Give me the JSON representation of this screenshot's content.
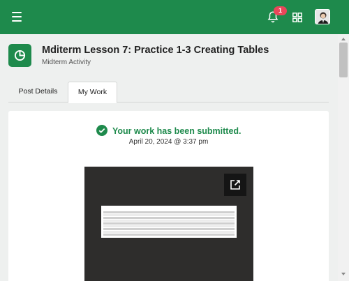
{
  "header": {
    "notification_count": "1",
    "accent_color": "#1e8a4c",
    "badge_color": "#e8475a",
    "icons": [
      "hamburger-icon",
      "bell-icon",
      "grid-icon",
      "avatar"
    ]
  },
  "post": {
    "icon": "pie-chart-icon",
    "title": "Mditerm Lesson 7: Practice 1-3 Creating Tables",
    "subtitle": "Midterm Activity"
  },
  "tabs": [
    {
      "label": "Post Details",
      "active": false
    },
    {
      "label": "My Work",
      "active": true
    }
  ],
  "submission": {
    "status": "Your work has been submitted.",
    "timestamp": "April 20, 2024 @ 3:37 pm",
    "preview_icon": "open-external-icon"
  }
}
